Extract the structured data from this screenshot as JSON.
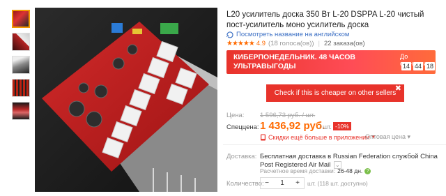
{
  "product": {
    "title": "L20 усилитель доска 350 Вт L-20 DSPPA L-20 чистый пост-усилитель моно усилитель доска",
    "translate_link": "Посмотреть название на английском",
    "stars": "★★★★★",
    "rating": "4.9",
    "votes": "(18 голоса(ов))",
    "orders": "22 заказа(ов)"
  },
  "promo": {
    "text": "КИБЕРПОНЕДЕЛЬНИК. 48 ЧАСОВ УЛЬТРАВЫГОДЫ",
    "until_label": "До окончания",
    "timer": [
      "14",
      "44",
      "18"
    ]
  },
  "cheaper_button": {
    "label": "Check if this is cheaper on other sellers",
    "close": "✖"
  },
  "price": {
    "old_label": "Цена:",
    "old_value": "1 596,73 руб. / шт.",
    "sale_label": "Спеццена:",
    "sale_value": "1 436,92 руб.",
    "per_unit": "/ шт.",
    "discount": "-10%",
    "app_discount": "Скидки ещё больше в приложении",
    "app_arrow": "▾",
    "wholesale": "Оптовая цена ▾"
  },
  "delivery": {
    "label": "Доставка:",
    "text": "Бесплатная доставка в Russian Federation службой China Post Registered Air Mail",
    "chevron": "⌄",
    "time_label": "Расчетное время доставки:",
    "time_value": "26-48 дн.",
    "help": "?"
  },
  "quantity": {
    "label": "Количество:",
    "minus": "−",
    "value": "1",
    "plus": "+",
    "note": "шт. (118 шт. доступно)"
  },
  "colors": {
    "accent": "#ff6a00",
    "red": "#e8332b",
    "link": "#3b6fc4"
  }
}
